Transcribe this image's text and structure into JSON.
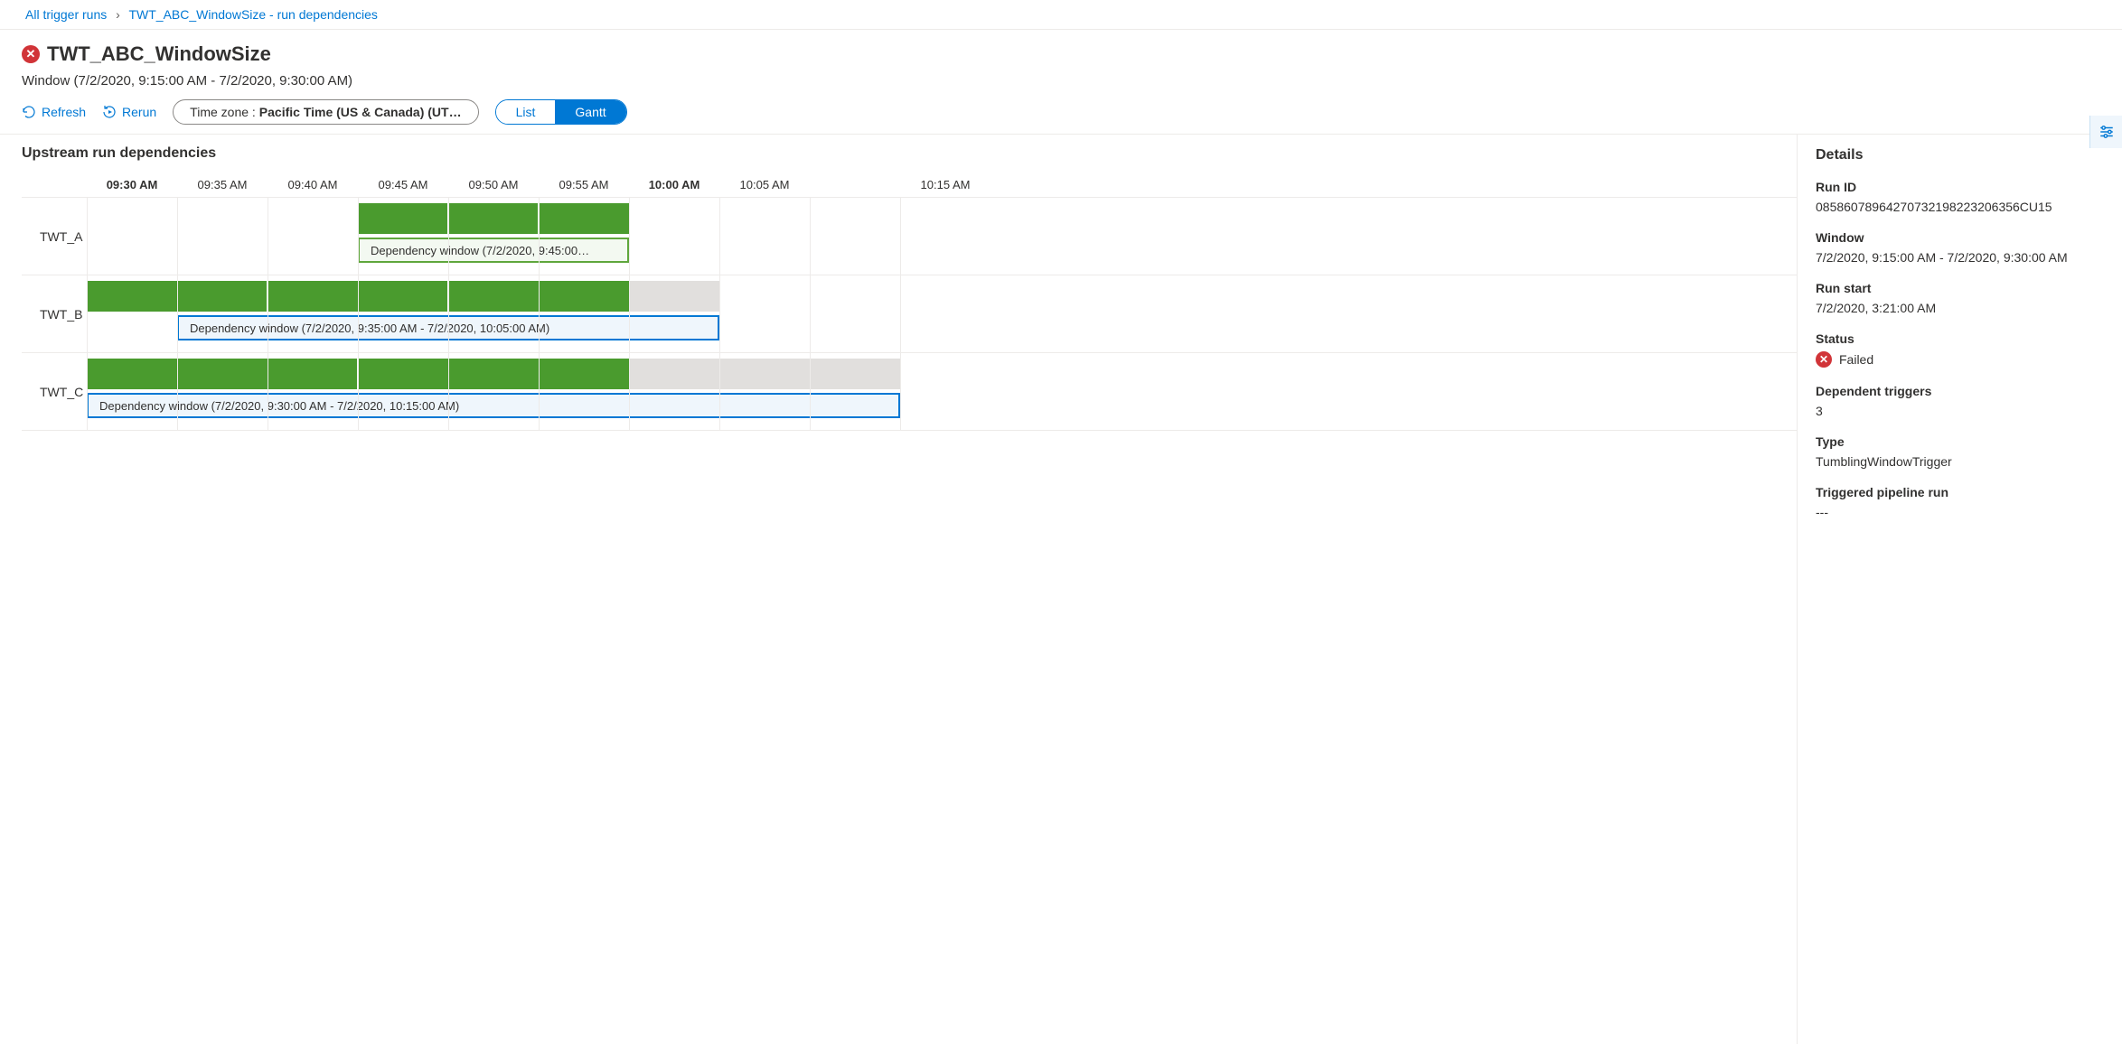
{
  "breadcrumb": {
    "root": "All trigger runs",
    "current": "TWT_ABC_WindowSize - run dependencies"
  },
  "header": {
    "title": "TWT_ABC_WindowSize",
    "window_text": "Window (7/2/2020, 9:15:00 AM - 7/2/2020, 9:30:00 AM)",
    "refresh_label": "Refresh",
    "rerun_label": "Rerun",
    "timezone_label": "Time zone : ",
    "timezone_value": "Pacific Time (US & Canada) (UT…",
    "view_list": "List",
    "view_gantt": "Gantt"
  },
  "gantt": {
    "section_title": "Upstream run dependencies",
    "times": [
      "09:30 AM",
      "09:35 AM",
      "09:40 AM",
      "09:45 AM",
      "09:50 AM",
      "09:55 AM",
      "10:00 AM",
      "10:05 AM",
      "",
      "10:15 AM"
    ],
    "bold_times": [
      "09:30 AM",
      "10:00 AM"
    ],
    "rows": {
      "a": {
        "label": "TWT_A",
        "dep_text": "Dependency window (7/2/2020, 9:45:00…"
      },
      "b": {
        "label": "TWT_B",
        "dep_text": "Dependency window (7/2/2020, 9:35:00 AM - 7/2/2020, 10:05:00 AM)"
      },
      "c": {
        "label": "TWT_C",
        "dep_text": "Dependency window (7/2/2020, 9:30:00 AM - 7/2/2020, 10:15:00 AM)"
      }
    }
  },
  "details": {
    "title": "Details",
    "labels": {
      "run_id": "Run ID",
      "window": "Window",
      "run_start": "Run start",
      "status": "Status",
      "dependent_triggers": "Dependent triggers",
      "type": "Type",
      "triggered_pipeline_run": "Triggered pipeline run"
    },
    "values": {
      "run_id": "08586078964270732198223206356CU15",
      "window": "7/2/2020, 9:15:00 AM - 7/2/2020, 9:30:00 AM",
      "run_start": "7/2/2020, 3:21:00 AM",
      "status": "Failed",
      "dependent_triggers": "3",
      "type": "TumblingWindowTrigger",
      "triggered_pipeline_run": "---"
    }
  }
}
